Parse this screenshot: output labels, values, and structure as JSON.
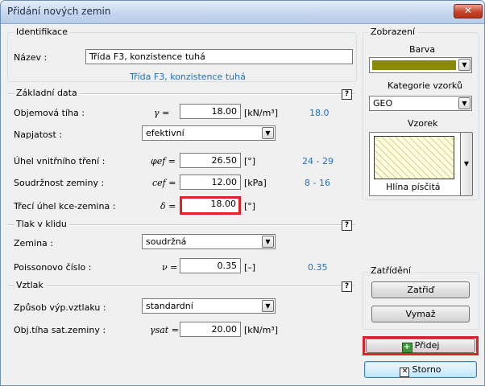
{
  "window": {
    "title": "Přidání nových zemin",
    "close_glyph": "✕"
  },
  "identifikace": {
    "section": "Identifikace",
    "name_label": "Název :",
    "name_value": "Třída F3, konzistence tuhá",
    "classification_text": "Třída F3, konzistence tuhá"
  },
  "zakladni": {
    "section": "Základní data",
    "help": "?",
    "rows": {
      "objemova": {
        "label": "Objemová tíha :",
        "sym": "γ =",
        "value": "18.00",
        "unit": "[kN/m³]",
        "hint": "18.0"
      },
      "napjatost": {
        "label": "Napjatost :",
        "value": "efektivní"
      },
      "uhel": {
        "label": "Úhel vnitřního tření :",
        "sym": "φef =",
        "value": "26.50",
        "unit": "[°]",
        "hint": "24 - 29"
      },
      "soudrznost": {
        "label": "Soudržnost zeminy :",
        "sym": "cef =",
        "value": "12.00",
        "unit": "[kPa]",
        "hint": "8 - 16"
      },
      "treci": {
        "label": "Třecí úhel kce-zemina :",
        "sym": "δ =",
        "value": "18.00",
        "unit": "[°]"
      }
    }
  },
  "tlak": {
    "section": "Tlak v klidu",
    "help": "?",
    "zemina": {
      "label": "Zemina :",
      "value": "soudržná"
    },
    "poisson": {
      "label": "Poissonovo číslo :",
      "sym": "ν =",
      "value": "0.35",
      "unit": "[–]",
      "hint": "0.35"
    }
  },
  "vztlak": {
    "section": "Vztlak",
    "help": "?",
    "zpusob": {
      "label": "Způsob výp.vztlaku :",
      "value": "standardní"
    },
    "obj_sat": {
      "label": "Obj.tíha sat.zeminy :",
      "sym": "γsat =",
      "value": "20.00",
      "unit": "[kN/m³]"
    }
  },
  "zobrazeni": {
    "section": "Zobrazení",
    "barva_label": "Barva",
    "barva_color": "#8a8a00",
    "kategorie_label": "Kategorie vzorků",
    "kategorie_value": "GEO",
    "vzorek_label": "Vzorek",
    "vzorek_name": "Hlína písčitá"
  },
  "zatrideni": {
    "section": "Zatřídění",
    "zatrid": "Zatřiď",
    "vymaz": "Vymaž"
  },
  "actions": {
    "pridej": "Přidej",
    "storno": "Storno"
  },
  "icons": {
    "dropdown": "▼",
    "add": "plus-icon",
    "cancel": "cross-box-icon"
  }
}
